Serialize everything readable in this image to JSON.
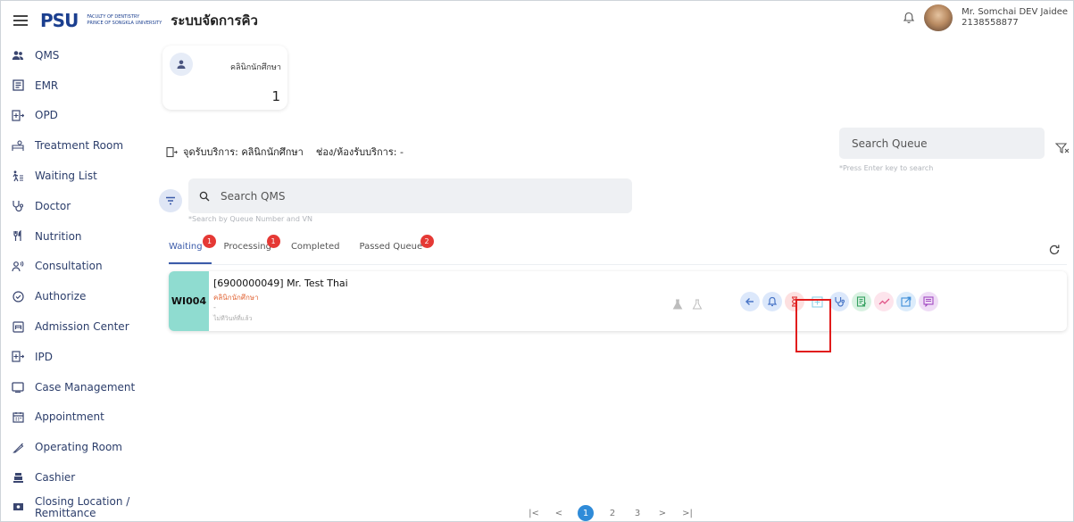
{
  "header": {
    "logo_mark": "PSU",
    "logo_line1": "FACULTY OF DENTISTRY",
    "logo_line2": "PRINCE OF SONGKLA UNIVERSITY",
    "app_title": "ระบบจัดการคิว",
    "user_name": "Mr. Somchai DEV Jaidee",
    "user_id": "2138558877"
  },
  "sidebar": {
    "items": [
      {
        "label": "QMS",
        "icon": "users-icon"
      },
      {
        "label": "EMR",
        "icon": "record-icon"
      },
      {
        "label": "OPD",
        "icon": "opd-icon"
      },
      {
        "label": "Treatment Room",
        "icon": "bed-icon"
      },
      {
        "label": "Waiting List",
        "icon": "walk-list-icon"
      },
      {
        "label": "Doctor",
        "icon": "stethoscope-icon"
      },
      {
        "label": "Nutrition",
        "icon": "utensils-icon"
      },
      {
        "label": "Consultation",
        "icon": "consult-icon"
      },
      {
        "label": "Authorize",
        "icon": "shield-check-icon"
      },
      {
        "label": "Admission Center",
        "icon": "admission-icon"
      },
      {
        "label": "IPD",
        "icon": "ipd-icon"
      },
      {
        "label": "Case Management",
        "icon": "folder-icon"
      },
      {
        "label": "Appointment",
        "icon": "calendar-icon"
      },
      {
        "label": "Operating Room",
        "icon": "scalpel-icon"
      },
      {
        "label": "Cashier",
        "icon": "cashier-icon"
      },
      {
        "label": "Closing Location / Remittance",
        "icon": "remit-icon"
      }
    ]
  },
  "summary_card": {
    "label": "คลินิกนักศึกษา",
    "count": "1"
  },
  "service": {
    "point": "จุดรับบริการ: คลินิกนักศึกษา",
    "room": "ช่อง/ห้องรับบริการ: -"
  },
  "search_qms": {
    "placeholder": "Search QMS",
    "hint": "*Search by Queue Number and VN"
  },
  "search_queue": {
    "placeholder": "Search Queue",
    "hint": "*Press Enter key to search"
  },
  "tabs": [
    {
      "label": "Waiting",
      "badge": "1"
    },
    {
      "label": "Processing",
      "badge": "1"
    },
    {
      "label": "Completed",
      "badge": ""
    },
    {
      "label": "Passed Queue",
      "badge": "2"
    }
  ],
  "queue": [
    {
      "queue_no": "WI004",
      "patient": "[6900000049] Mr. Test Thai",
      "clinic": "คลินิกนักศึกษา",
      "line3": "-",
      "note": "ไม่ทีวินท์ที่แล้ว"
    }
  ],
  "pagination": {
    "first": "|<",
    "prev": "<",
    "pages": [
      "1",
      "2",
      "3"
    ],
    "current": "1",
    "next": ">",
    "last": ">|"
  }
}
